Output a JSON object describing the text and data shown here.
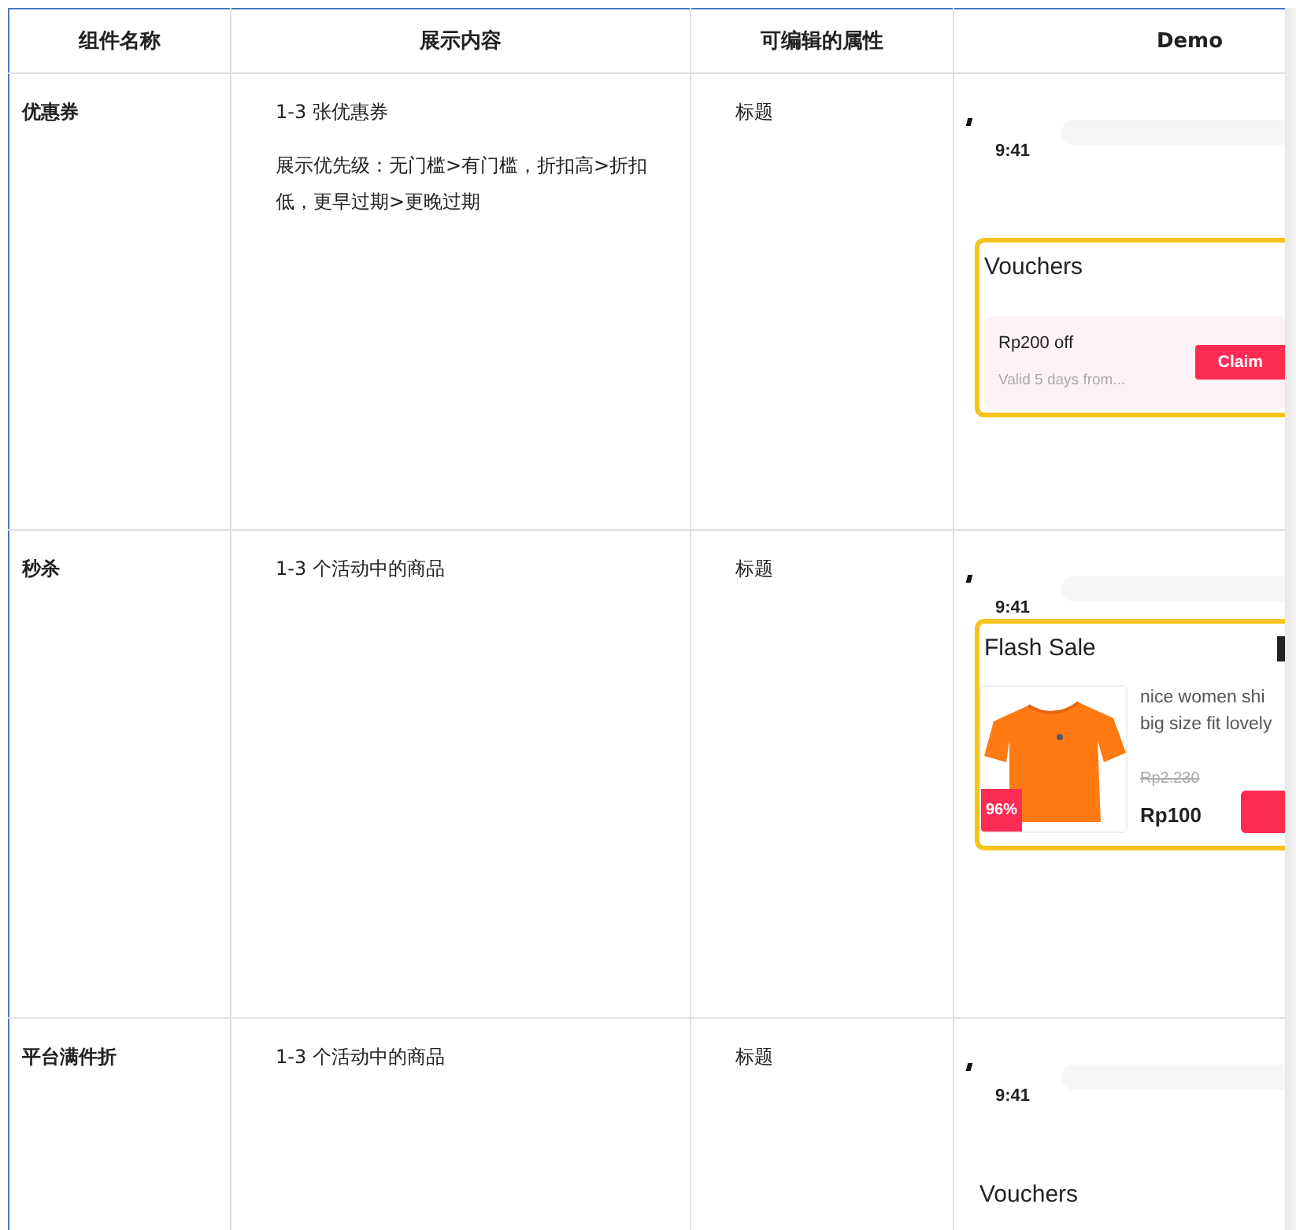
{
  "table": {
    "columns": [
      "组件名称",
      "展示内容",
      "可编辑的属性",
      "Demo"
    ],
    "rows": [
      {
        "name": "优惠券",
        "content": [
          "1-3 张优惠券",
          "展示优先级：无门槛>有门槛，折扣高>折扣低，更早过期>更晚过期"
        ],
        "attributes": "标题",
        "demo": {
          "kind": "voucher",
          "time": "9:41",
          "title": "Vouchers",
          "voucher_amount": "Rp200 off",
          "voucher_validity": "Valid 5 days from...",
          "claim_label": "Claim"
        }
      },
      {
        "name": "秒杀",
        "content": [
          "1-3 个活动中的商品"
        ],
        "attributes": "标题",
        "demo": {
          "kind": "flash_sale",
          "time": "9:41",
          "title": "Flash Sale",
          "discount_badge": "96%",
          "product_name_lines": [
            "nice women shi",
            "big size fit lovely"
          ],
          "original_price": "Rp2.230",
          "price": "Rp100"
        }
      },
      {
        "name": "平台满件折",
        "content": [
          "1-3 个活动中的商品"
        ],
        "attributes": "标题",
        "demo": {
          "kind": "title_only",
          "time": "9:41",
          "title": "Vouchers"
        }
      }
    ]
  }
}
